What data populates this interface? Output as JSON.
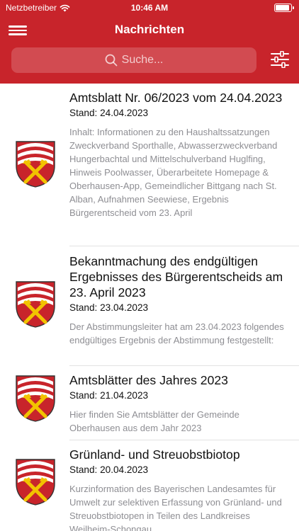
{
  "status_bar": {
    "carrier": "Netzbetreiber",
    "time": "10:46 AM"
  },
  "header": {
    "title": "Nachrichten"
  },
  "search": {
    "placeholder": "Suche..."
  },
  "news": [
    {
      "title": "Amtsblatt Nr. 06/2023 vom 24.04.2023",
      "date": "Stand: 24.04.2023",
      "description": "Inhalt: Informationen zu den Haushaltssatzungen Zweckverband Sporthalle, Abwasserzweckverband Hungerbachtal und Mittelschulverband Huglfing, Hinweis Poolwasser, Überarbeitete Homepage & Oberhausen-App, Gemeindlicher Bittgang nach St. Alban, Aufnahmen Seewiese, Ergebnis Bürgerentscheid vom 23. April"
    },
    {
      "title": "Bekanntmachung des endgültigen Ergebnisses des Bürgerentscheids am 23. April 2023",
      "date": "Stand: 23.04.2023",
      "description": "Der Abstimmungsleiter hat am 23.04.2023 folgendes endgültiges Ergebnis der Abstimmung festgestellt:"
    },
    {
      "title": "Amtsblätter des Jahres 2023",
      "date": "Stand: 21.04.2023",
      "description": "Hier finden Sie Amtsblätter der Gemeinde Oberhausen aus dem Jahr 2023"
    },
    {
      "title": "Grünland- und Streuobstbiotop",
      "date": "Stand: 20.04.2023",
      "description": "Kurzinformation des Bayerischen Landesamtes für Umwelt zur selektiven Erfassung von Grünland- und Streuobstbiotopen in Teilen des Landkreises Weilheim-Schongau"
    }
  ],
  "colors": {
    "brand": "#c8242b",
    "crest_gold": "#f2c300",
    "muted_text": "#8e8e93"
  },
  "icons": {
    "menu": "hamburger-icon",
    "search": "search-icon",
    "filter": "sliders-icon",
    "crest": "coat-of-arms-icon"
  }
}
